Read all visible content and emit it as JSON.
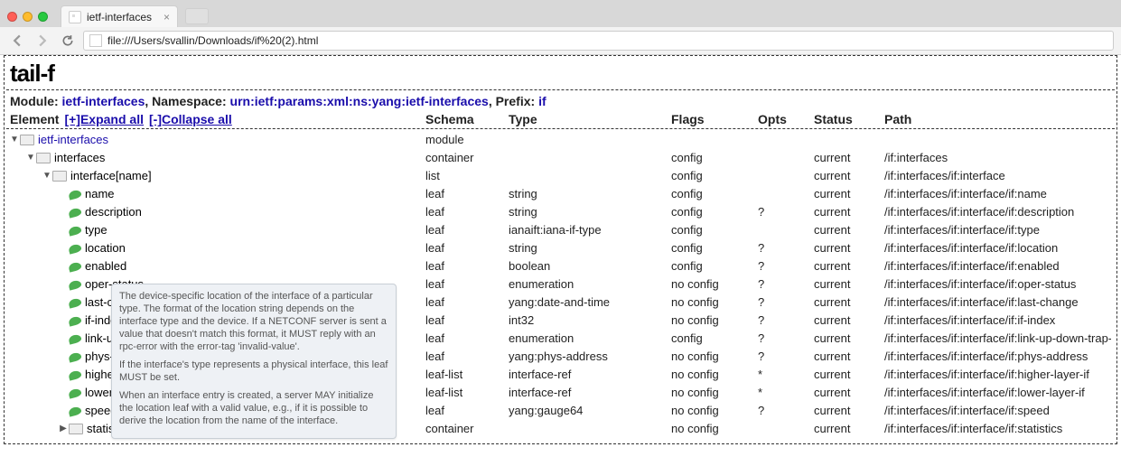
{
  "browser": {
    "tab_title": "ietf-interfaces",
    "url": "file:///Users/svallin/Downloads/if%20(2).html"
  },
  "logo": "tail-f",
  "meta": {
    "module_label": "Module:",
    "module": "ietf-interfaces",
    "namespace_label": ", Namespace:",
    "namespace": "urn:ietf:params:xml:ns:yang:ietf-interfaces",
    "prefix_label": ", Prefix:",
    "prefix": "if"
  },
  "headers": {
    "element": "Element",
    "expand": "[+]Expand all",
    "collapse": "[-]Collapse all",
    "schema": "Schema",
    "type": "Type",
    "flags": "Flags",
    "opts": "Opts",
    "status": "Status",
    "path": "Path"
  },
  "rows": [
    {
      "indent": 0,
      "twisty": "down",
      "nodeicon": "box",
      "name": "ietf-interfaces",
      "link": true,
      "schema": "module",
      "type": "",
      "flags": "",
      "opts": "",
      "status": "",
      "path": ""
    },
    {
      "indent": 1,
      "twisty": "down",
      "nodeicon": "box",
      "name": "interfaces",
      "schema": "container",
      "type": "",
      "flags": "config",
      "opts": "",
      "status": "current",
      "path": "/if:interfaces"
    },
    {
      "indent": 2,
      "twisty": "down",
      "nodeicon": "box",
      "name": "interface[name]",
      "schema": "list",
      "type": "",
      "flags": "config",
      "opts": "",
      "status": "current",
      "path": "/if:interfaces/if:interface"
    },
    {
      "indent": 3,
      "twisty": "",
      "nodeicon": "leaf",
      "name": "name",
      "schema": "leaf",
      "type": "string",
      "flags": "config",
      "opts": "",
      "status": "current",
      "path": "/if:interfaces/if:interface/if:name"
    },
    {
      "indent": 3,
      "twisty": "",
      "nodeicon": "leaf",
      "name": "description",
      "schema": "leaf",
      "type": "string",
      "flags": "config",
      "opts": "?",
      "status": "current",
      "path": "/if:interfaces/if:interface/if:description"
    },
    {
      "indent": 3,
      "twisty": "",
      "nodeicon": "leaf",
      "name": "type",
      "schema": "leaf",
      "type": "ianaift:iana-if-type",
      "flags": "config",
      "opts": "",
      "status": "current",
      "path": "/if:interfaces/if:interface/if:type"
    },
    {
      "indent": 3,
      "twisty": "",
      "nodeicon": "leaf",
      "name": "location",
      "schema": "leaf",
      "type": "string",
      "flags": "config",
      "opts": "?",
      "status": "current",
      "path": "/if:interfaces/if:interface/if:location"
    },
    {
      "indent": 3,
      "twisty": "",
      "nodeicon": "leaf",
      "name": "enabled",
      "schema": "leaf",
      "type": "boolean",
      "flags": "config",
      "opts": "?",
      "status": "current",
      "path": "/if:interfaces/if:interface/if:enabled"
    },
    {
      "indent": 3,
      "twisty": "",
      "nodeicon": "leaf",
      "name": "oper-status",
      "namegrey": "status",
      "schema": "leaf",
      "type": "enumeration",
      "flags": "no config",
      "opts": "?",
      "status": "current",
      "path": "/if:interfaces/if:interface/if:oper-status"
    },
    {
      "indent": 3,
      "twisty": "",
      "nodeicon": "leaf",
      "name": "last-change",
      "namegrey": "change",
      "schema": "leaf",
      "type": "yang:date-and-time",
      "flags": "no config",
      "opts": "?",
      "status": "current",
      "path": "/if:interfaces/if:interface/if:last-change"
    },
    {
      "indent": 3,
      "twisty": "",
      "nodeicon": "leaf",
      "name": "if-index",
      "namegrey": "index",
      "schema": "leaf",
      "type": "int32",
      "flags": "no config",
      "opts": "?",
      "status": "current",
      "path": "/if:interfaces/if:interface/if:if-index"
    },
    {
      "indent": 3,
      "twisty": "",
      "nodeicon": "leaf",
      "name": "link-up-down-trap-enable",
      "namegrey": "down-trap-enable",
      "schema": "leaf",
      "type": "enumeration",
      "flags": "config",
      "opts": "?",
      "status": "current",
      "path": "/if:interfaces/if:interface/if:link-up-down-trap-en"
    },
    {
      "indent": 3,
      "twisty": "",
      "nodeicon": "leaf",
      "name": "phys-address",
      "namegrey": "address",
      "schema": "leaf",
      "type": "yang:phys-address",
      "flags": "no config",
      "opts": "?",
      "status": "current",
      "path": "/if:interfaces/if:interface/if:phys-address"
    },
    {
      "indent": 3,
      "twisty": "",
      "nodeicon": "leaf",
      "name": "higher-layer-if",
      "namegrey": "layer-if",
      "schema": "leaf-list",
      "type": "interface-ref",
      "flags": "no config",
      "opts": "*",
      "status": "current",
      "path": "/if:interfaces/if:interface/if:higher-layer-if"
    },
    {
      "indent": 3,
      "twisty": "",
      "nodeicon": "leaf",
      "name": "lower-layer-if",
      "namegrey": "layer-if",
      "schema": "leaf-list",
      "type": "interface-ref",
      "flags": "no config",
      "opts": "*",
      "status": "current",
      "path": "/if:interfaces/if:interface/if:lower-layer-if"
    },
    {
      "indent": 3,
      "twisty": "",
      "nodeicon": "leaf",
      "name": "speed",
      "namegrey": "",
      "schema": "leaf",
      "type": "yang:gauge64",
      "flags": "no config",
      "opts": "?",
      "status": "current",
      "path": "/if:interfaces/if:interface/if:speed"
    },
    {
      "indent": 3,
      "twisty": "right",
      "nodeicon": "box",
      "name": "statistics",
      "namegrey": "",
      "schema": "container",
      "type": "",
      "flags": "no config",
      "opts": "",
      "status": "current",
      "path": "/if:interfaces/if:interface/if:statistics"
    }
  ],
  "tooltip": {
    "p1": "The device-specific location of the interface of a particular type.  The format of the location string depends on the interface type and the device.  If a NETCONF server is sent a value that doesn't match this format, it MUST reply with an rpc-error with the error-tag 'invalid-value'.",
    "p2": "If the interface's type represents a physical interface, this leaf MUST be set.",
    "p3": "When an interface entry is created, a server MAY initialize the location leaf with a valid value, e.g., if it is possible to derive the location from the name of the interface."
  }
}
